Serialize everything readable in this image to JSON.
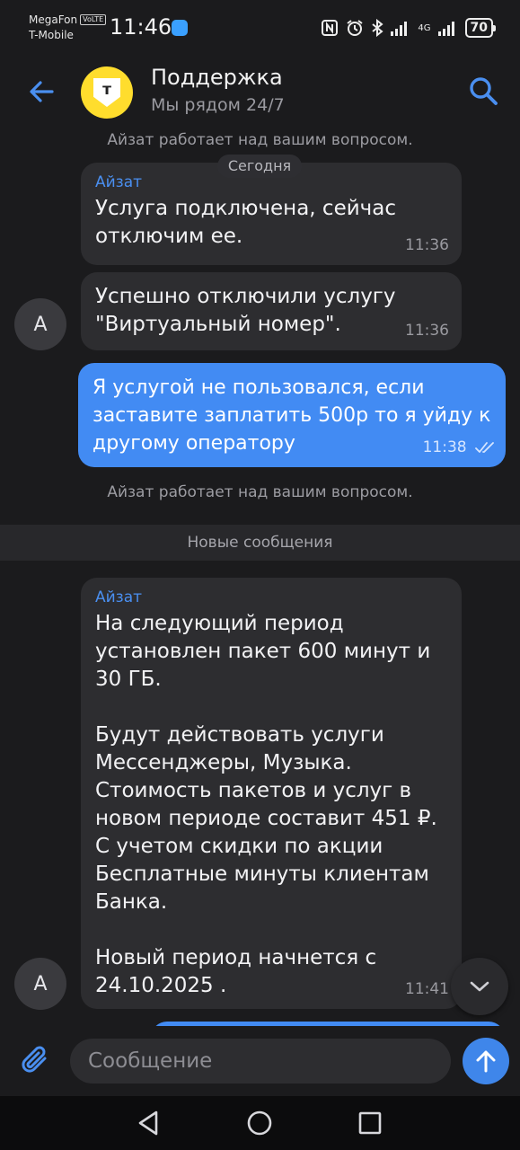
{
  "status_bar": {
    "carrier_1": "MegaFon",
    "volte_badge": "VoLTE",
    "carrier_2": "T-Mobile",
    "time": "11:46",
    "network": "4G",
    "battery": "70"
  },
  "header": {
    "title": "Поддержка",
    "subtitle": "Мы рядом 24/7",
    "logo_letter": "т"
  },
  "feed": {
    "typing_note_1": "Айзат работает над вашим вопросом.",
    "date_label": "Сегодня",
    "messages": [
      {
        "sender": "Айзат",
        "text": "Услуга подключена, сейчас\nотключим ее.",
        "time": "11:36"
      },
      {
        "text": "Успешно отключили услугу\n\"Виртуальный номер\".",
        "time": "11:36",
        "avatar_letter": "А"
      },
      {
        "text": "Я услугой не пользовался, если\nзаставите заплатить 500р то я уйду к\nдругому оператору",
        "time": "11:38",
        "status": "read"
      }
    ],
    "typing_note_2": "Айзат работает над вашим вопросом.",
    "new_messages_label": "Новые сообщения",
    "last_message": {
      "sender": "Айзат",
      "text": "На следующий период\nустановлен пакет 600 минут и\n30 ГБ.\n\nБудут действовать услуги\nМессенджеры, Музыка.\nСтоимость пакетов и услуг в\nновом периоде составит 451 ₽.\nС учетом скидки по акции\nБесплатные минуты клиентам\nБанка.\n\nНовый период начнется с\n24.10.2025 .",
      "time": "11:41",
      "avatar_letter": "А"
    }
  },
  "composer": {
    "placeholder": "Сообщение"
  },
  "colors": {
    "background": "#1b1b1d",
    "incoming_bubble": "#2d2d30",
    "outgoing_bubble": "#428bf3",
    "accent": "#4a8ff0",
    "logo_yellow": "#ffdd2d"
  }
}
